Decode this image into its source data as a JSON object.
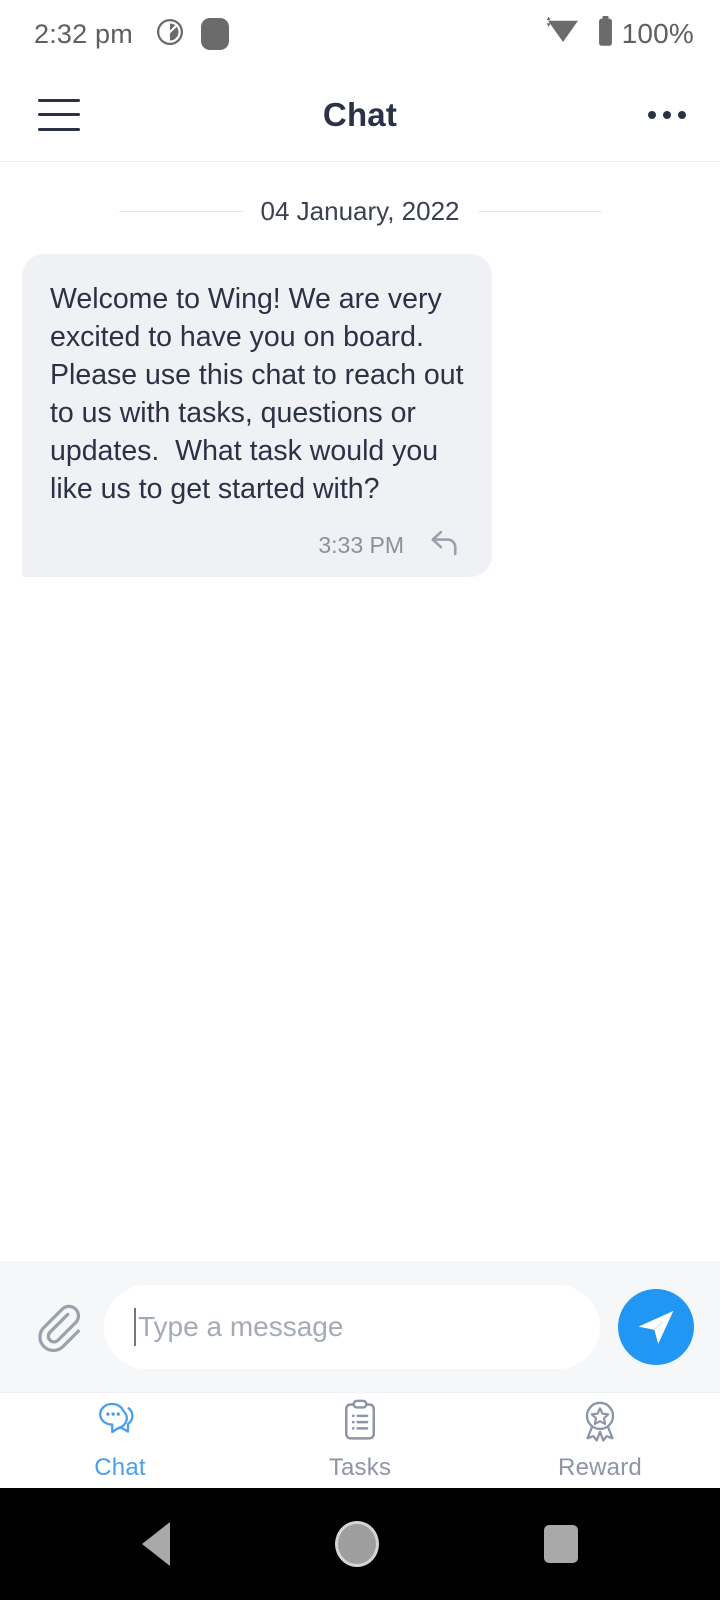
{
  "status_bar": {
    "time": "2:32 pm",
    "dnd_icon": "do-not-disturb-icon",
    "app_icon": "rounded-square-app-icon",
    "wifi_icon": "wifi-icon",
    "battery_icon": "battery-full-icon",
    "battery_percent": "100%"
  },
  "header": {
    "menu_icon": "hamburger-menu-icon",
    "title": "Chat",
    "overflow_icon": "more-options-icon"
  },
  "chat": {
    "date_divider": "04 January, 2022",
    "messages": [
      {
        "text": "Welcome to Wing! We are very excited to have you on board. Please use this chat to reach out to us with tasks, questions or updates.  What task would you like us to get started with?",
        "time": "3:33 PM",
        "reply_icon": "reply-arrow-icon",
        "direction": "incoming"
      }
    ]
  },
  "input_bar": {
    "attach_icon": "paperclip-icon",
    "placeholder": "Type a message",
    "value": "",
    "send_icon": "send-icon"
  },
  "tab_bar": {
    "tabs": [
      {
        "label": "Chat",
        "icon": "chat-bubbles-icon",
        "active": true
      },
      {
        "label": "Tasks",
        "icon": "clipboard-list-icon",
        "active": false
      },
      {
        "label": "Reward",
        "icon": "award-medal-icon",
        "active": false
      }
    ]
  },
  "nav_bar": {
    "back_icon": "android-back-icon",
    "home_icon": "android-home-icon",
    "recents_icon": "android-recents-icon"
  },
  "colors": {
    "accent": "#2196f3",
    "tab_active": "#4a9fe8",
    "tab_inactive": "#8d95a6",
    "bubble_bg": "#f0f1f5",
    "text_primary": "#2b3245",
    "input_bar_bg": "#f5f7f9"
  }
}
